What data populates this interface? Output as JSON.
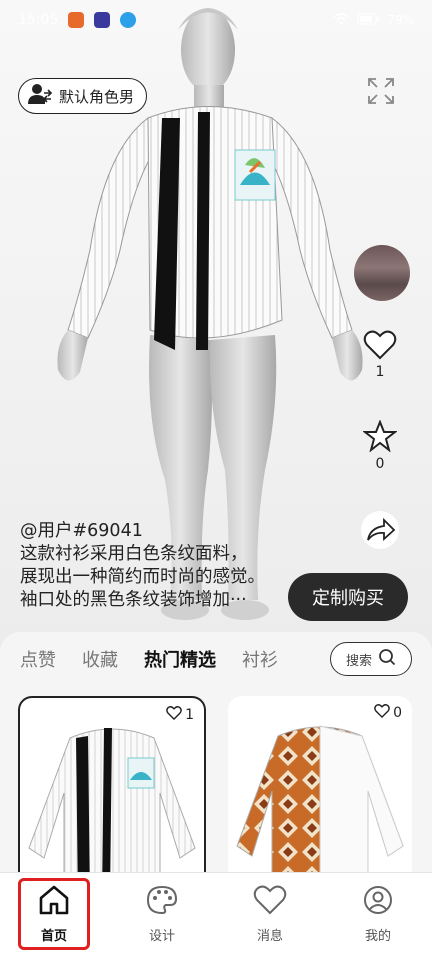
{
  "status_bar": {
    "time": "15:05",
    "battery": "79%",
    "app_icon_colors": [
      "#e8692c",
      "#3a3a9e",
      "#2aa0e8"
    ]
  },
  "stage": {
    "avatar_button_label": "默认角色男",
    "likes_count": "1",
    "favorites_count": "0",
    "username": "@用户#69041",
    "description_lines": [
      "这款衬衫采用白色条纹面料，",
      "展现出一种简约而时尚的感觉。",
      "袖口处的黑色条纹装饰增加···"
    ],
    "buy_button_label": "定制购买"
  },
  "tabs": [
    {
      "label": "点赞",
      "active": false
    },
    {
      "label": "收藏",
      "active": false
    },
    {
      "label": "热门精选",
      "active": true
    },
    {
      "label": "衬衫",
      "active": false
    }
  ],
  "search": {
    "label": "搜索"
  },
  "cards": [
    {
      "likes": "1",
      "selected": true
    },
    {
      "likes": "0",
      "selected": false
    }
  ],
  "bottom_nav": [
    {
      "label": "首页",
      "icon": "home-icon",
      "active": true
    },
    {
      "label": "设计",
      "icon": "palette-icon",
      "active": false
    },
    {
      "label": "消息",
      "icon": "heart-icon",
      "active": false
    },
    {
      "label": "我的",
      "icon": "user-icon",
      "active": false
    }
  ],
  "colors": {
    "highlight": "#e02020",
    "button_dark": "#2a2a2a"
  }
}
